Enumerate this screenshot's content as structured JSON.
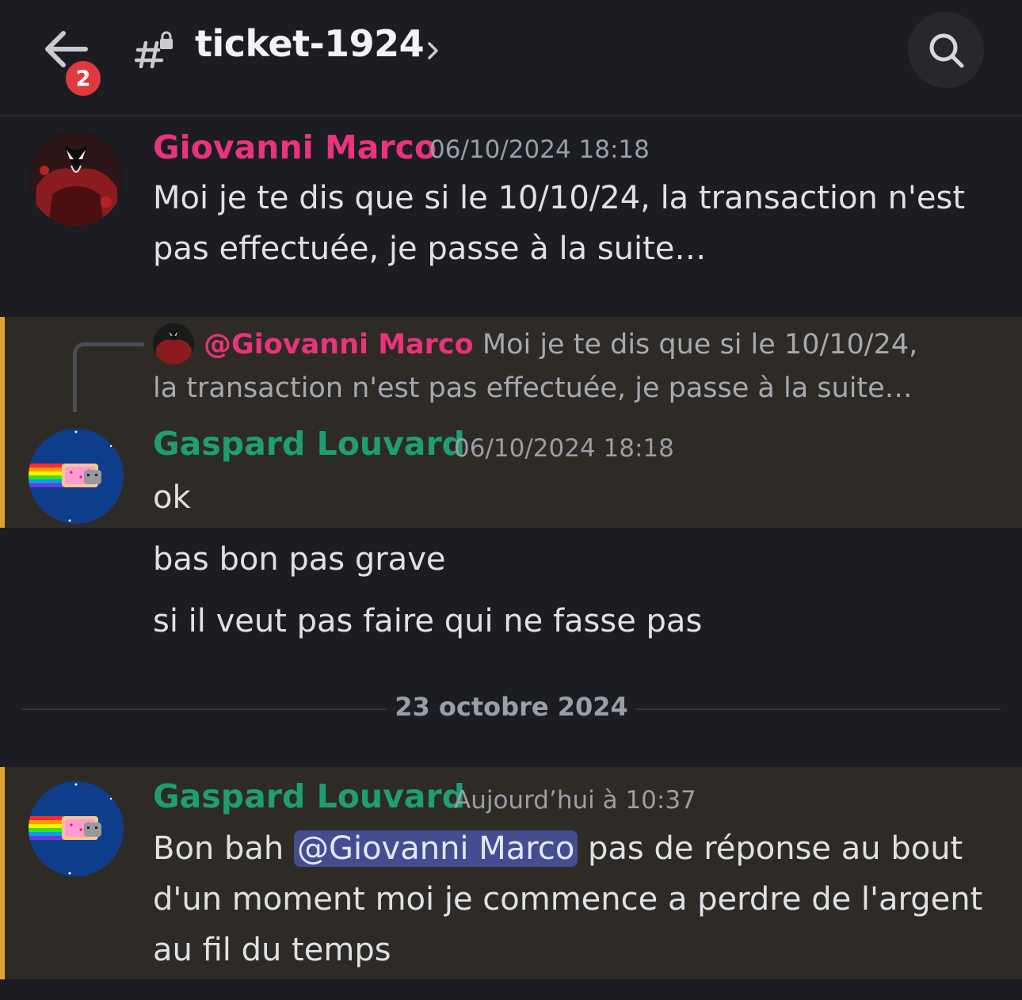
{
  "header": {
    "back_badge": "2",
    "channel_name": "ticket-1924"
  },
  "messages": [
    {
      "author": "Giovanni Marco",
      "author_color": "#e8347a",
      "timestamp": "06/10/2024 18:18",
      "lines": [
        "Moi je te dis que si le 10/10/24, la transaction n'est pas effectuée, je passe à la suite…"
      ]
    },
    {
      "reply": {
        "author": "@Giovanni Marco",
        "text": "Moi je te dis que si le 10/10/24, la transaction n'est pas effectuée, je passe à la suite…"
      },
      "author": "Gaspard Louvard",
      "author_color": "#1f9e74",
      "timestamp": "06/10/2024 18:18",
      "lines": [
        "ok",
        "bas bon pas grave",
        "si il veut pas faire qui ne fasse pas"
      ]
    },
    {
      "author": "Gaspard Louvard",
      "author_color": "#1f9e74",
      "timestamp": "Aujourd’hui à 10:37",
      "text_before": "Bon bah",
      "mention": "@Giovanni Marco",
      "text_after": "pas de réponse au bout d'un moment moi je commence a perdre de l'argent au fil du temps"
    }
  ],
  "date_divider": "23 octobre 2024",
  "colors": {
    "background": "#1c1d22",
    "highlight_bg": "#2e2a26",
    "highlight_bar": "#e0a42a",
    "badge": "#e03a3f",
    "mention_bg": "#454c8f"
  }
}
